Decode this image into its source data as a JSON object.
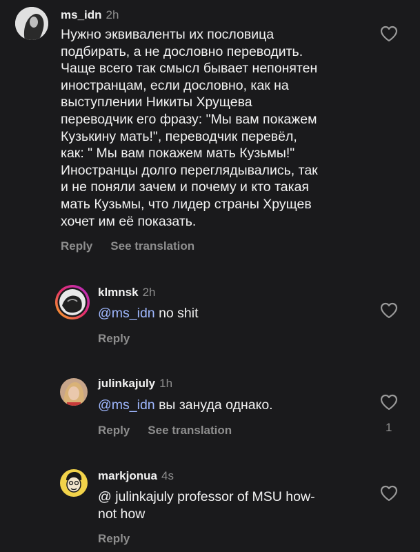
{
  "comments": [
    {
      "username": "ms_idn",
      "time": "2h",
      "text": "Нужно эквиваленты их пословица\nподбирать, а не дословно переводить.\nЧаще всего так смысл бывает непонятен\nиностранцам, если дословно, как на\nвыступлении Никиты Хрущева\nпереводчик его фразу: \"Мы вам покажем\nКузькину мать!\", переводчик перевёл,\nкак: \" Мы вам покажем мать Кузьмы!\"\nИностранцы долго переглядывались, так\nи не поняли зачем и почему и кто такая\nмать Кузьмы, что лидер страны Хрущев\nхочет им её показать.",
      "reply_label": "Reply",
      "see_translation_label": "See translation",
      "avatar_icon": "avatar-photo-icon"
    },
    {
      "username": "klmnsk",
      "time": "2h",
      "mention": "@ms_idn",
      "text": " no shit",
      "reply_label": "Reply",
      "avatar_icon": "avatar-story-ring-icon"
    },
    {
      "username": "julinkajuly",
      "time": "1h",
      "mention": "@ms_idn",
      "text": " вы зануда однако.",
      "reply_label": "Reply",
      "see_translation_label": "See translation",
      "like_count": "1",
      "avatar_icon": "avatar-photo-icon"
    },
    {
      "username": "markjonua",
      "time": "4s",
      "text": "@ julinkajuly professor of MSU how-\nnot how",
      "reply_label": "Reply",
      "avatar_icon": "avatar-cartoon-icon"
    }
  ],
  "colors": {
    "background": "#1a1a1c",
    "text": "#f2f2f2",
    "secondary": "#8e8e8e",
    "mention": "#9fb8ff"
  }
}
